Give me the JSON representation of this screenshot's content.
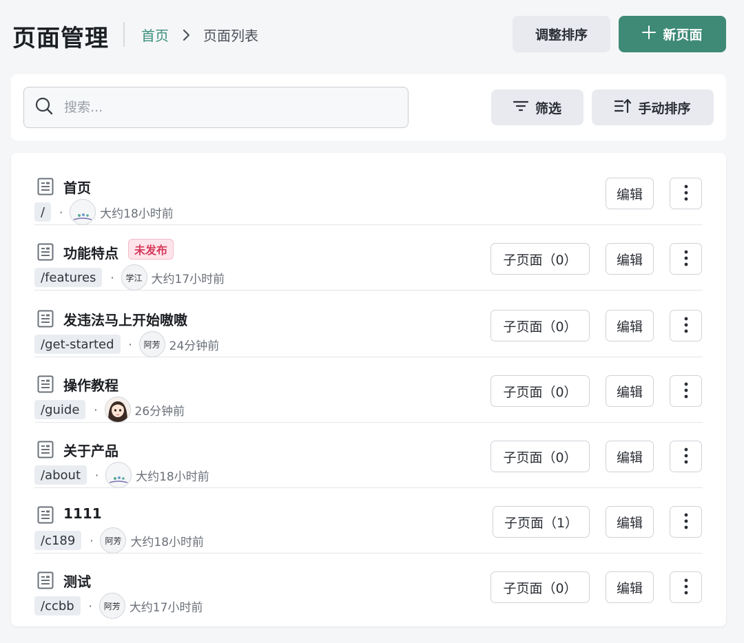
{
  "header": {
    "title": "页面管理",
    "breadcrumb": {
      "home": "首页",
      "current": "页面列表"
    },
    "adjust_sort_label": "调整排序",
    "new_page_label": "新页面"
  },
  "toolbar": {
    "search_placeholder": "搜索...",
    "filter_label": "筛选",
    "manual_sort_label": "手动排序"
  },
  "colors": {
    "primary": "#3e8a76",
    "badge_text": "#d63b5e",
    "badge_bg": "#fde4ea"
  },
  "rows": [
    {
      "title": "首页",
      "badge": "",
      "slug": "/",
      "avatar": "",
      "avatar_icon": "scenery-avatar",
      "time": "大约18小时前",
      "children_label": "",
      "edit_label": "编辑"
    },
    {
      "title": "功能特点",
      "badge": "未发布",
      "slug": "/features",
      "avatar": "学江",
      "avatar_icon": "",
      "time": "大约17小时前",
      "children_label": "子页面（0）",
      "edit_label": "编辑"
    },
    {
      "title": "发违法马上开始嗷嗷",
      "badge": "",
      "slug": "/get-started",
      "avatar": "阿芳",
      "avatar_icon": "",
      "time": "24分钟前",
      "children_label": "子页面（0）",
      "edit_label": "编辑"
    },
    {
      "title": "操作教程",
      "badge": "",
      "slug": "/guide",
      "avatar": "",
      "avatar_icon": "girl-avatar",
      "time": "26分钟前",
      "children_label": "子页面（0）",
      "edit_label": "编辑"
    },
    {
      "title": "关于产品",
      "badge": "",
      "slug": "/about",
      "avatar": "",
      "avatar_icon": "scenery-avatar",
      "time": "大约18小时前",
      "children_label": "子页面（0）",
      "edit_label": "编辑"
    },
    {
      "title": "1111",
      "badge": "",
      "slug": "/c189",
      "avatar": "阿芳",
      "avatar_icon": "",
      "time": "大约18小时前",
      "children_label": "子页面（1）",
      "edit_label": "编辑"
    },
    {
      "title": "测试",
      "badge": "",
      "slug": "/ccbb",
      "avatar": "阿芳",
      "avatar_icon": "",
      "time": "大约17小时前",
      "children_label": "子页面（0）",
      "edit_label": "编辑"
    }
  ]
}
